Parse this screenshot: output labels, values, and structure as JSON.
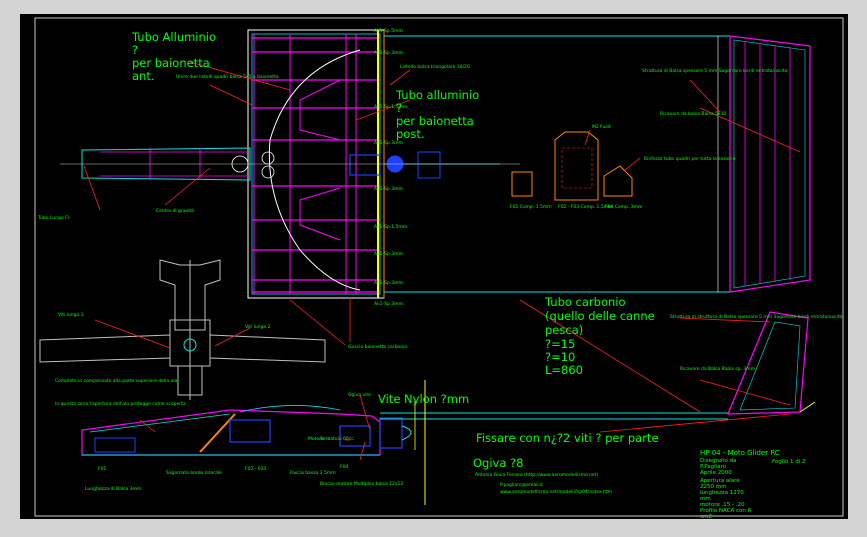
{
  "colors": {
    "frame": "#d4d4d4",
    "background": "#000000",
    "border": "#c8c8c8",
    "cyan": "#00e5e5",
    "magenta": "#ff00ff",
    "white": "#ffffff",
    "yellow": "#ffff00",
    "green": "#00ff00",
    "red": "#ff2020",
    "blue": "#2040ff",
    "orange": "#ff8800",
    "gray": "#c0c0c0"
  },
  "labels": {
    "tubo_all_ant": [
      "Tubo Alluminio",
      "?",
      "per baionetta",
      "ant."
    ],
    "tubo_all_post": [
      "Tubo alluminio",
      "?",
      "per baionetta",
      "post."
    ],
    "tubo_carbonio": [
      "Tubo carbonio",
      "(quello delle canne",
      "pesca)",
      "?=15",
      "?=10",
      "L=860"
    ],
    "vite_nylon": "Vite Nylon ?mm",
    "fissare": "Fissare con n¿?2 viti ? per parte",
    "ogiva": "Ogiva ?8",
    "title_block": [
      "HP 04 - Moto Glider RC",
      "Disegnato da",
      "P.Pagliaro",
      "Aprile 2000",
      "Apertura alare",
      "2250 mm",
      "lunghezza 1270",
      "mm",
      "motore .15 - .20",
      "Profilo NACA con 6",
      "cm2"
    ],
    "sheet": "Foglio 1 di 2",
    "small": {
      "sp_top": "Ali1-Sp.5mm",
      "sp_1": "Ali1-Sp.3mm",
      "sp_2": "Ali1-Sp.1.5mm",
      "sp_3": "Ali1-Sp.3mm",
      "sp_4": "Ali1-Sp.3mm",
      "sp_5": "Ali1-Sp.1.5mm",
      "sp_6": "Ali1-Sp.3mm",
      "sp_7": "Ali1-Sp.3mm",
      "sp_8": "Ali1-Sp.3mm",
      "listello": "Listello balsa triangolare 10/20",
      "unire": "Unire due listelli quadri balsa 5x5 a baionetta",
      "tubo_lungo": "Tubo Lungo Fl.",
      "centro": "Centro di gravità",
      "struttura_ali": "Struttura di Balsa spessore 5 mm Sagomare bordi entrata/uscita",
      "ricavare": "Ricavare da balsa Balsa 5x10",
      "mezzo": "M2 Fusit",
      "rinforzo": "Rinforzo tubo quadri per tutta la sezione",
      "f01": "F01 Comp. 1.5mm",
      "f02": "F02 - F03 Comp. 1.5mm",
      "f04": "F04 Comp. 3mm",
      "viti_lungo_1": "Viti lungo 1",
      "viti_lungo_2": "Viti lungo 2",
      "guscio": "Guscio baionetta carbonio",
      "struttura_coda": "Struttura di struttura di Balsa spessore 5 mm Sagomare bordi entrata/uscita",
      "ricavare2": "Ricavare da Balsa Balsa sp. 3mm",
      "complete": "Complete in compensato alla parte superiore della ala",
      "in_questa": "In questa zona l'apertura dell'ala protegge come scoperta",
      "lunghezza": "Lunghezza di Balsa 3mm",
      "ogive": "Ogiva vite",
      "sagomato": "Sagomato bordo laterale",
      "mot1": "Motore",
      "f01b": "F01",
      "f02b": "F02 - F03",
      "fascia": "Fascia bassa 3.5mm",
      "blocco": "Blocco motore Multiplex balsa 12x12",
      "serbatoio": "Serbatoio 60cc",
      "f04b": "F04",
      "note1": "Antonio Gioia Ferraro (http://www.aeromodellismo.net)",
      "note2": "P.pagliaro@email.it",
      "note3": "www.aeromodellismo.net/modelli/hp04/index.htm"
    }
  }
}
